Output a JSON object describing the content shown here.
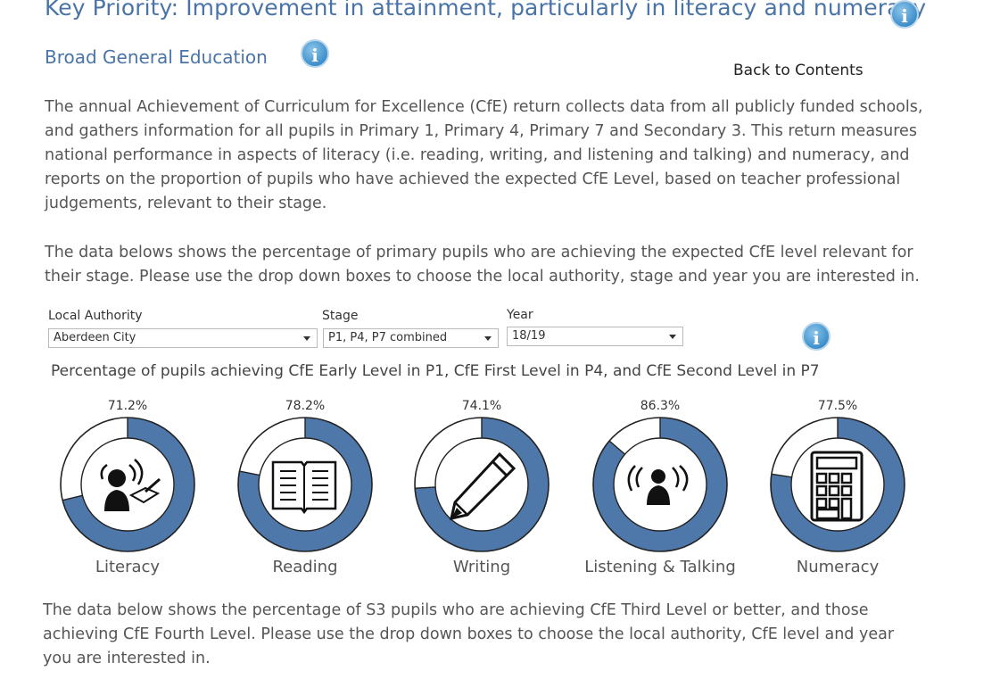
{
  "header": {
    "title": "Key Priority: Improvement in attainment, particularly in literacy and numeracy",
    "subtitle": "Broad General Education",
    "back_link": "Back to Contents"
  },
  "intro": {
    "para1": "The annual Achievement of Curriculum for Excellence (CfE) return collects data from all publicly funded schools, and gathers information for all pupils in Primary 1, Primary 4, Primary 7 and Secondary 3.  This return measures national performance in aspects of literacy (i.e. reading, writing, and listening and talking) and numeracy, and reports on the proportion of pupils who have achieved the expected CfE Level, based on teacher professional judgements, relevant to their stage.",
    "para2": "The data belows shows the percentage of primary pupils who are achieving the expected CfE level relevant for their stage. Please use the drop down boxes to choose the local authority, stage and year you are interested in."
  },
  "filters": {
    "local_authority": {
      "label": "Local Authority",
      "value": "Aberdeen City"
    },
    "stage": {
      "label": "Stage",
      "value": "P1, P4, P7 combined"
    },
    "year": {
      "label": "Year",
      "value": "18/19"
    }
  },
  "colors": {
    "accent": "#4a74a8",
    "ring_fill": "#4e78a9",
    "ring_empty": "#ffffff",
    "ring_border": "#222222"
  },
  "chart_data": {
    "type": "pie",
    "title": "Percentage of pupils achieving  CfE Early Level in P1, CfE First Level in P4, and CfE Second Level in P7",
    "categories": [
      "Literacy",
      "Reading",
      "Writing",
      "Listening & Talking",
      "Numeracy"
    ],
    "values": [
      71.2,
      78.2,
      74.1,
      86.3,
      77.5
    ],
    "value_labels": [
      "71.2%",
      "78.2%",
      "74.1%",
      "86.3%",
      "77.5%"
    ],
    "icons": [
      "listening-reading-icon",
      "book-icon",
      "pencil-icon",
      "listening-icon",
      "calculator-icon"
    ]
  },
  "outro": {
    "para3": "The data below shows the percentage of S3 pupils who are achieving CfE Third Level or better, and those achieving CfE Fourth Level. Please use the drop down boxes to choose the local authority, CfE level and year you are interested in."
  }
}
